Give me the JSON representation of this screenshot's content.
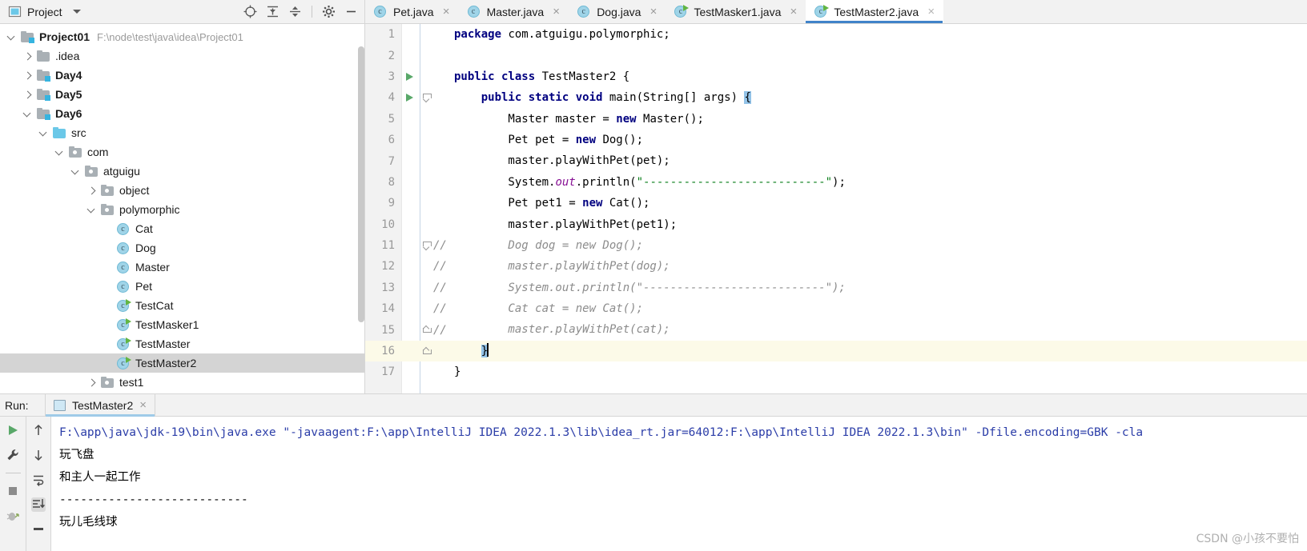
{
  "project_panel": {
    "title": "Project",
    "dropdown_icon": "chevron-down-icon",
    "toolbar_icons": [
      "locate-icon",
      "expand-all-icon",
      "collapse-all-icon",
      "settings-gear-icon",
      "hide-icon"
    ],
    "tree": [
      {
        "indent": 0,
        "twisty": "down",
        "icon": "module-folder",
        "label": "Project01",
        "bold": true,
        "path": "F:\\node\\test\\java\\idea\\Project01",
        "selected": false
      },
      {
        "indent": 1,
        "twisty": "right",
        "icon": "folder",
        "label": ".idea",
        "bold": false,
        "path": "",
        "selected": false
      },
      {
        "indent": 1,
        "twisty": "right",
        "icon": "module-folder",
        "label": "Day4",
        "bold": true,
        "path": "",
        "selected": false
      },
      {
        "indent": 1,
        "twisty": "right",
        "icon": "module-folder",
        "label": "Day5",
        "bold": true,
        "path": "",
        "selected": false
      },
      {
        "indent": 1,
        "twisty": "down",
        "icon": "module-folder",
        "label": "Day6",
        "bold": true,
        "path": "",
        "selected": false
      },
      {
        "indent": 2,
        "twisty": "down",
        "icon": "source-folder",
        "label": "src",
        "bold": false,
        "path": "",
        "selected": false
      },
      {
        "indent": 3,
        "twisty": "down",
        "icon": "package",
        "label": "com",
        "bold": false,
        "path": "",
        "selected": false
      },
      {
        "indent": 4,
        "twisty": "down",
        "icon": "package",
        "label": "atguigu",
        "bold": false,
        "path": "",
        "selected": false
      },
      {
        "indent": 5,
        "twisty": "right",
        "icon": "package",
        "label": "object",
        "bold": false,
        "path": "",
        "selected": false
      },
      {
        "indent": 5,
        "twisty": "down",
        "icon": "package",
        "label": "polymorphic",
        "bold": false,
        "path": "",
        "selected": false
      },
      {
        "indent": 6,
        "twisty": "none",
        "icon": "class",
        "label": "Cat",
        "bold": false,
        "path": "",
        "selected": false
      },
      {
        "indent": 6,
        "twisty": "none",
        "icon": "class",
        "label": "Dog",
        "bold": false,
        "path": "",
        "selected": false
      },
      {
        "indent": 6,
        "twisty": "none",
        "icon": "class",
        "label": "Master",
        "bold": false,
        "path": "",
        "selected": false
      },
      {
        "indent": 6,
        "twisty": "none",
        "icon": "class",
        "label": "Pet",
        "bold": false,
        "path": "",
        "selected": false
      },
      {
        "indent": 6,
        "twisty": "none",
        "icon": "runnable-class",
        "label": "TestCat",
        "bold": false,
        "path": "",
        "selected": false
      },
      {
        "indent": 6,
        "twisty": "none",
        "icon": "runnable-class",
        "label": "TestMasker1",
        "bold": false,
        "path": "",
        "selected": false
      },
      {
        "indent": 6,
        "twisty": "none",
        "icon": "runnable-class",
        "label": "TestMaster",
        "bold": false,
        "path": "",
        "selected": false
      },
      {
        "indent": 6,
        "twisty": "none",
        "icon": "runnable-class",
        "label": "TestMaster2",
        "bold": false,
        "path": "",
        "selected": true
      },
      {
        "indent": 5,
        "twisty": "right",
        "icon": "package",
        "label": "test1",
        "bold": false,
        "path": "",
        "selected": false
      }
    ]
  },
  "editor_tabs": [
    {
      "label": "Pet.java",
      "icon": "class",
      "active": false,
      "close": "×"
    },
    {
      "label": "Master.java",
      "icon": "class",
      "active": false,
      "close": "×"
    },
    {
      "label": "Dog.java",
      "icon": "class",
      "active": false,
      "close": "×"
    },
    {
      "label": "TestMasker1.java",
      "icon": "runnable-class",
      "active": false,
      "close": "×"
    },
    {
      "label": "TestMaster2.java",
      "icon": "runnable-class",
      "active": true,
      "close": "×"
    }
  ],
  "editor": {
    "lines": [
      {
        "n": "1",
        "gutter_run": false,
        "fold": "none",
        "comment_mark": "",
        "caret_line": false,
        "tokens": [
          {
            "t": "package",
            "c": "kw"
          },
          {
            "t": " com.atguigu.polymorphic;",
            "c": ""
          }
        ]
      },
      {
        "n": "2",
        "gutter_run": false,
        "fold": "none",
        "comment_mark": "",
        "caret_line": false,
        "tokens": []
      },
      {
        "n": "3",
        "gutter_run": true,
        "fold": "none",
        "comment_mark": "",
        "caret_line": false,
        "tokens": [
          {
            "t": "public class",
            "c": "kw"
          },
          {
            "t": " TestMaster2 {",
            "c": ""
          }
        ]
      },
      {
        "n": "4",
        "gutter_run": true,
        "fold": "down",
        "comment_mark": "",
        "caret_line": false,
        "tokens": [
          {
            "t": "    ",
            "c": ""
          },
          {
            "t": "public static void",
            "c": "kw"
          },
          {
            "t": " main(String[] args) ",
            "c": ""
          },
          {
            "t": "{",
            "c": "brace-hl"
          }
        ]
      },
      {
        "n": "5",
        "gutter_run": false,
        "fold": "none",
        "comment_mark": "",
        "caret_line": false,
        "tokens": [
          {
            "t": "        Master master = ",
            "c": ""
          },
          {
            "t": "new",
            "c": "kw"
          },
          {
            "t": " Master();",
            "c": ""
          }
        ]
      },
      {
        "n": "6",
        "gutter_run": false,
        "fold": "none",
        "comment_mark": "",
        "caret_line": false,
        "tokens": [
          {
            "t": "        Pet pet = ",
            "c": ""
          },
          {
            "t": "new",
            "c": "kw"
          },
          {
            "t": " Dog();",
            "c": ""
          }
        ]
      },
      {
        "n": "7",
        "gutter_run": false,
        "fold": "none",
        "comment_mark": "",
        "caret_line": false,
        "tokens": [
          {
            "t": "        master.playWithPet(pet);",
            "c": ""
          }
        ]
      },
      {
        "n": "8",
        "gutter_run": false,
        "fold": "none",
        "comment_mark": "",
        "caret_line": false,
        "tokens": [
          {
            "t": "        System.",
            "c": ""
          },
          {
            "t": "out",
            "c": "stat"
          },
          {
            "t": ".println(",
            "c": ""
          },
          {
            "t": "\"---------------------------\"",
            "c": "str"
          },
          {
            "t": ");",
            "c": ""
          }
        ]
      },
      {
        "n": "9",
        "gutter_run": false,
        "fold": "none",
        "comment_mark": "",
        "caret_line": false,
        "tokens": [
          {
            "t": "        Pet pet1 = ",
            "c": ""
          },
          {
            "t": "new",
            "c": "kw"
          },
          {
            "t": " Cat();",
            "c": ""
          }
        ]
      },
      {
        "n": "10",
        "gutter_run": false,
        "fold": "none",
        "comment_mark": "",
        "caret_line": false,
        "tokens": [
          {
            "t": "        master.playWithPet(pet1);",
            "c": ""
          }
        ]
      },
      {
        "n": "11",
        "gutter_run": false,
        "fold": "down",
        "comment_mark": "//",
        "caret_line": false,
        "tokens": [
          {
            "t": "        Dog dog = new Dog();",
            "c": "cmt"
          }
        ]
      },
      {
        "n": "12",
        "gutter_run": false,
        "fold": "none",
        "comment_mark": "//",
        "caret_line": false,
        "tokens": [
          {
            "t": "        master.playWithPet(dog);",
            "c": "cmt"
          }
        ]
      },
      {
        "n": "13",
        "gutter_run": false,
        "fold": "none",
        "comment_mark": "//",
        "caret_line": false,
        "tokens": [
          {
            "t": "        System.out.println(\"---------------------------\");",
            "c": "cmt"
          }
        ]
      },
      {
        "n": "14",
        "gutter_run": false,
        "fold": "none",
        "comment_mark": "//",
        "caret_line": false,
        "tokens": [
          {
            "t": "        Cat cat = new Cat();",
            "c": "cmt"
          }
        ]
      },
      {
        "n": "15",
        "gutter_run": false,
        "fold": "up",
        "comment_mark": "//",
        "caret_line": false,
        "tokens": [
          {
            "t": "        master.playWithPet(cat);",
            "c": "cmt"
          }
        ]
      },
      {
        "n": "16",
        "gutter_run": false,
        "fold": "up",
        "comment_mark": "",
        "caret_line": true,
        "tokens": [
          {
            "t": "    ",
            "c": ""
          },
          {
            "t": "}",
            "c": "brace-hl caret"
          }
        ]
      },
      {
        "n": "17",
        "gutter_run": false,
        "fold": "none",
        "comment_mark": "",
        "caret_line": false,
        "tokens": [
          {
            "t": "}",
            "c": ""
          }
        ]
      }
    ]
  },
  "run_panel": {
    "label": "Run:",
    "tab_label": "TestMaster2",
    "tab_close": "×",
    "tab_icon": "run-config-icon",
    "tools_left": [
      "rerun-play-icon",
      "wrench-settings-icon",
      "stop-square-icon",
      "debug-bug-icon"
    ],
    "tools_right": [
      "scroll-up-icon",
      "scroll-down-icon",
      "soft-wrap-icon",
      "scroll-to-end-icon",
      "print-icon"
    ],
    "console_lines": [
      {
        "text": "F:\\app\\java\\jdk-19\\bin\\java.exe \"-javaagent:F:\\app\\IntelliJ IDEA 2022.1.3\\lib\\idea_rt.jar=64012:F:\\app\\IntelliJ IDEA 2022.1.3\\bin\" -Dfile.encoding=GBK -cla",
        "kind": "cmd"
      },
      {
        "text": "玩飞盘",
        "kind": "cjk"
      },
      {
        "text": "和主人一起工作",
        "kind": "cjk"
      },
      {
        "text": "---------------------------",
        "kind": "out"
      },
      {
        "text": "玩儿毛线球",
        "kind": "cjk"
      }
    ]
  },
  "watermark": "CSDN @小孩不要怕",
  "colors": {
    "accent": "#4083c9",
    "keyword": "#000080",
    "string": "#067d17",
    "comment": "#8c8c8c",
    "static_field": "#871094",
    "run_green": "#59a869",
    "selection": "#d4d4d4",
    "caret_line": "#fcfae8",
    "brace_match": "#93c3e8"
  }
}
